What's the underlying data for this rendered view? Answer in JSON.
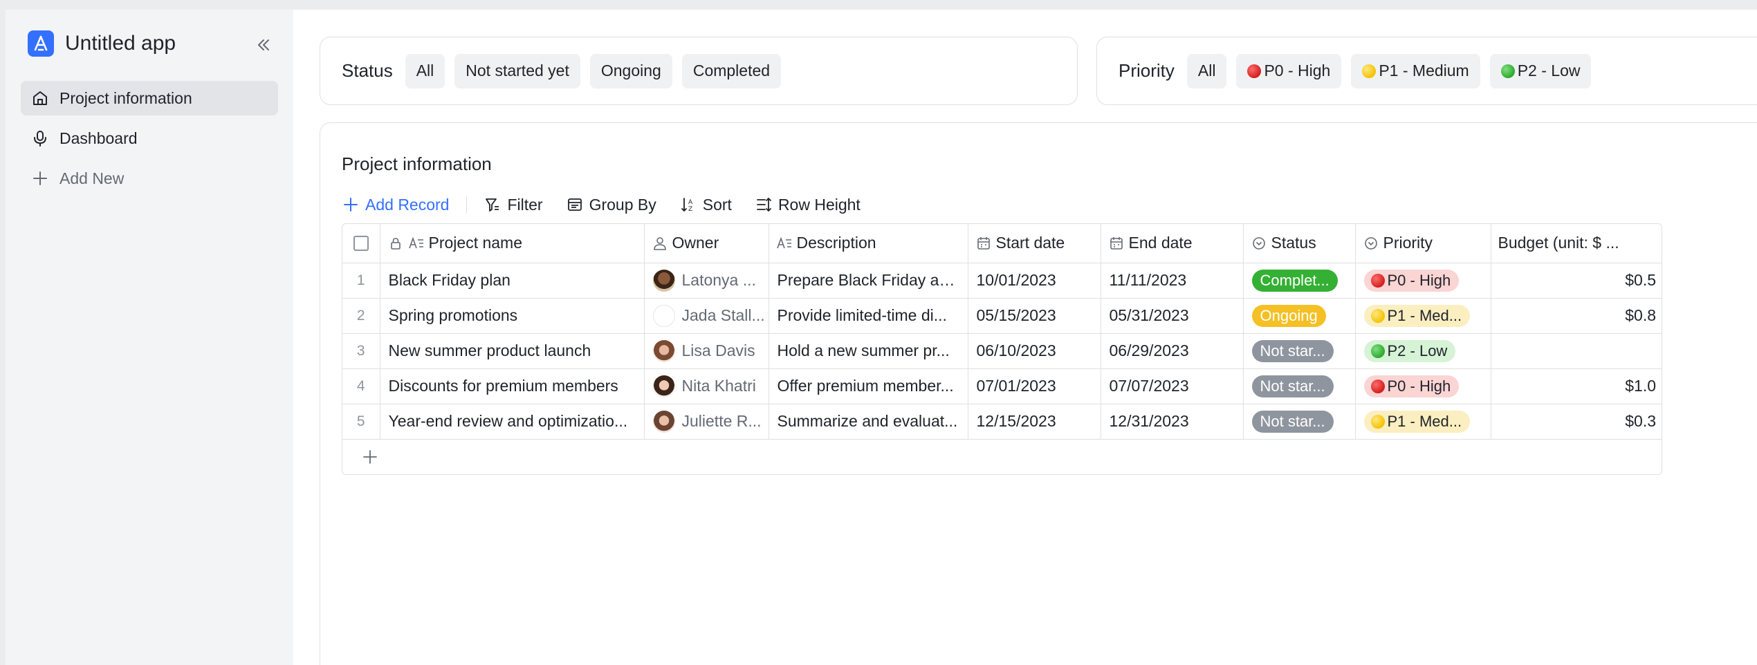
{
  "app": {
    "name": "Untitled app",
    "brand_color": "#3370ff"
  },
  "sidebar": {
    "items": [
      {
        "label": "Project information",
        "icon": "home-icon",
        "active": true
      },
      {
        "label": "Dashboard",
        "icon": "microphone-icon",
        "active": false
      },
      {
        "label": "Add New",
        "icon": "plus-icon",
        "active": false
      }
    ]
  },
  "filters": {
    "status": {
      "title": "Status",
      "options": [
        "All",
        "Not started yet",
        "Ongoing",
        "Completed"
      ]
    },
    "priority": {
      "title": "Priority",
      "options": [
        {
          "label": "All",
          "dot": ""
        },
        {
          "label": "P0 - High",
          "dot": "red"
        },
        {
          "label": "P1 - Medium",
          "dot": "yellow"
        },
        {
          "label": "P2 - Low",
          "dot": "green"
        }
      ]
    }
  },
  "table": {
    "title": "Project information",
    "toolbar": {
      "add_record": "Add Record",
      "filter": "Filter",
      "group_by": "Group By",
      "sort": "Sort",
      "row_height": "Row Height"
    },
    "columns": [
      "Project name",
      "Owner",
      "Description",
      "Start date",
      "End date",
      "Status",
      "Priority",
      "Budget (unit: $ ..."
    ],
    "rows": [
      {
        "num": "1",
        "name": "Black Friday plan",
        "owner": "Latonya ...",
        "description": "Prepare Black Friday ac...",
        "start": "10/01/2023",
        "end": "11/11/2023",
        "status": "Complet...",
        "status_kind": "done",
        "priority": "P0 - High",
        "priority_kind": "high",
        "budget": "$0.5"
      },
      {
        "num": "2",
        "name": "Spring promotions",
        "owner": "Jada Stall...",
        "description": "Provide limited-time di...",
        "start": "05/15/2023",
        "end": "05/31/2023",
        "status": "Ongoing",
        "status_kind": "ongoing",
        "priority": "P1 - Med...",
        "priority_kind": "med",
        "budget": "$0.8"
      },
      {
        "num": "3",
        "name": "New summer product launch",
        "owner": "Lisa Davis",
        "description": "Hold a new summer pr...",
        "start": "06/10/2023",
        "end": "06/29/2023",
        "status": "Not star...",
        "status_kind": "not",
        "priority": "P2 - Low",
        "priority_kind": "low",
        "budget": ""
      },
      {
        "num": "4",
        "name": "Discounts for premium members",
        "owner": "Nita Khatri",
        "description": "Offer premium member...",
        "start": "07/01/2023",
        "end": "07/07/2023",
        "status": "Not star...",
        "status_kind": "not",
        "priority": "P0 - High",
        "priority_kind": "high",
        "budget": "$1.0"
      },
      {
        "num": "5",
        "name": "Year-end review and optimizatio...",
        "owner": "Juliette R...",
        "description": "Summarize and evaluat...",
        "start": "12/15/2023",
        "end": "12/31/2023",
        "status": "Not star...",
        "status_kind": "not",
        "priority": "P1 - Med...",
        "priority_kind": "med",
        "budget": "$0.3"
      }
    ]
  }
}
